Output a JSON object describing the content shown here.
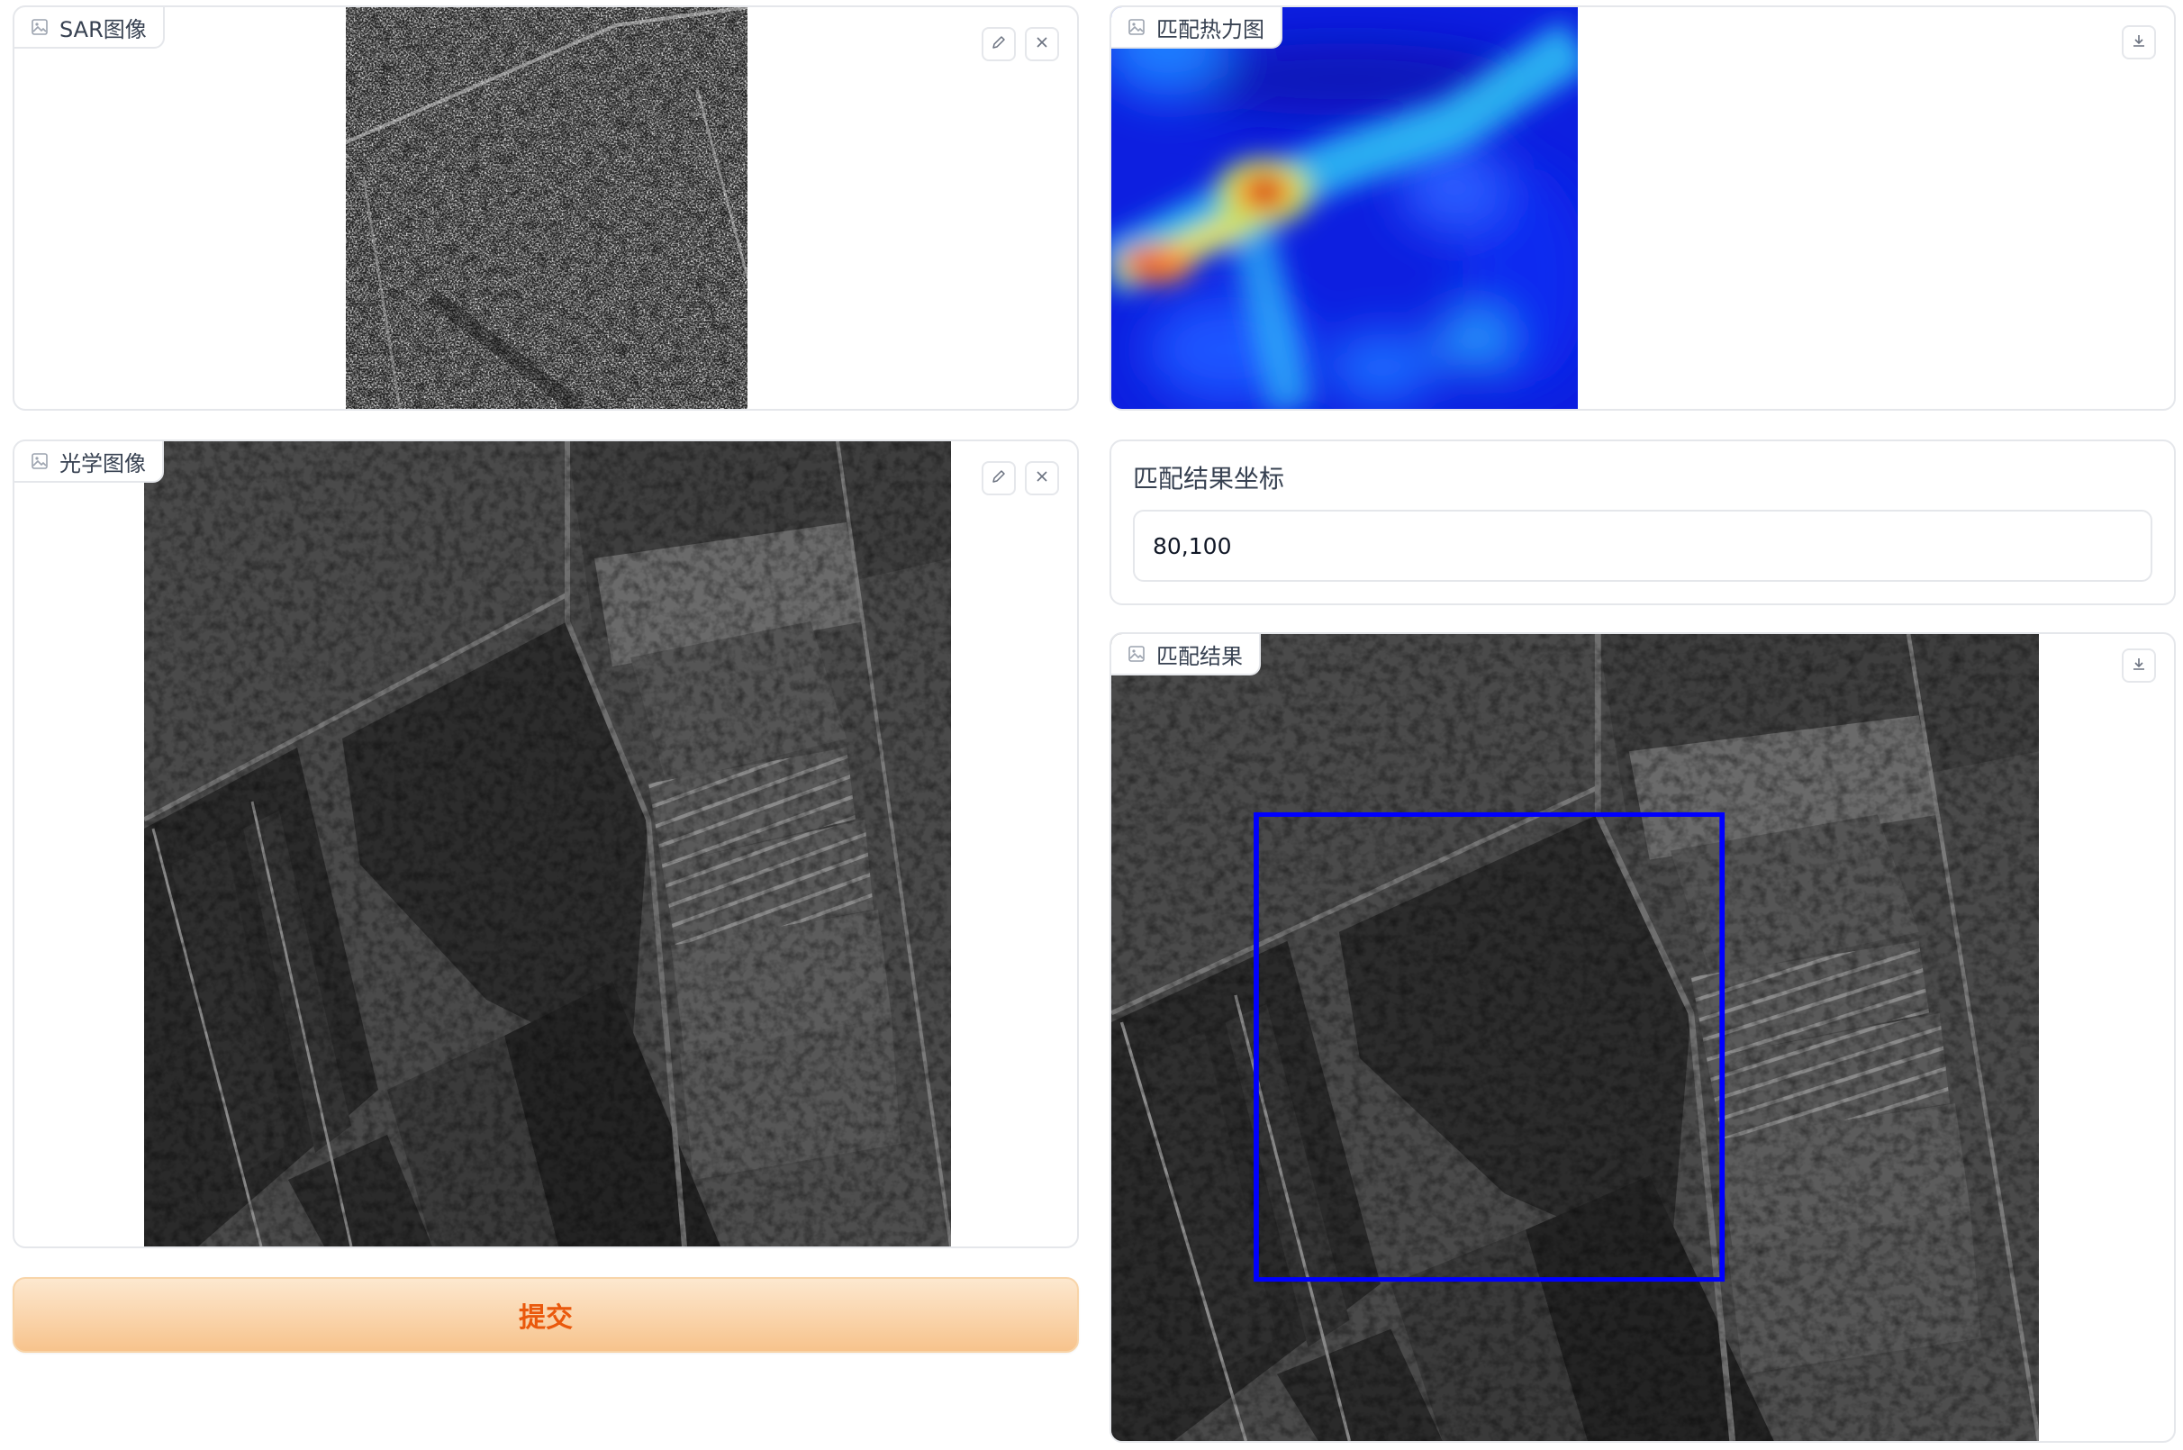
{
  "sar_panel": {
    "label": "SAR图像",
    "icon": "image-icon",
    "buttons": [
      "edit-icon",
      "close-icon"
    ]
  },
  "optical_panel": {
    "label": "光学图像",
    "icon": "image-icon",
    "buttons": [
      "edit-icon",
      "close-icon"
    ]
  },
  "heatmap_panel": {
    "label": "匹配热力图",
    "icon": "image-icon",
    "buttons": [
      "download-icon"
    ]
  },
  "coords_panel": {
    "label": "匹配结果坐标",
    "value": "80,100"
  },
  "result_panel": {
    "label": "匹配结果",
    "icon": "image-icon",
    "buttons": [
      "download-icon"
    ],
    "box_color": "#0000ff"
  },
  "submit": {
    "label": "提交",
    "text_color": "#ea580c"
  },
  "colors": {
    "border": "#e5e7eb",
    "label_text": "#374151",
    "heat_low": "#0a1fd6",
    "heat_mid": "#22d3ee",
    "heat_high": "#dc2626"
  }
}
